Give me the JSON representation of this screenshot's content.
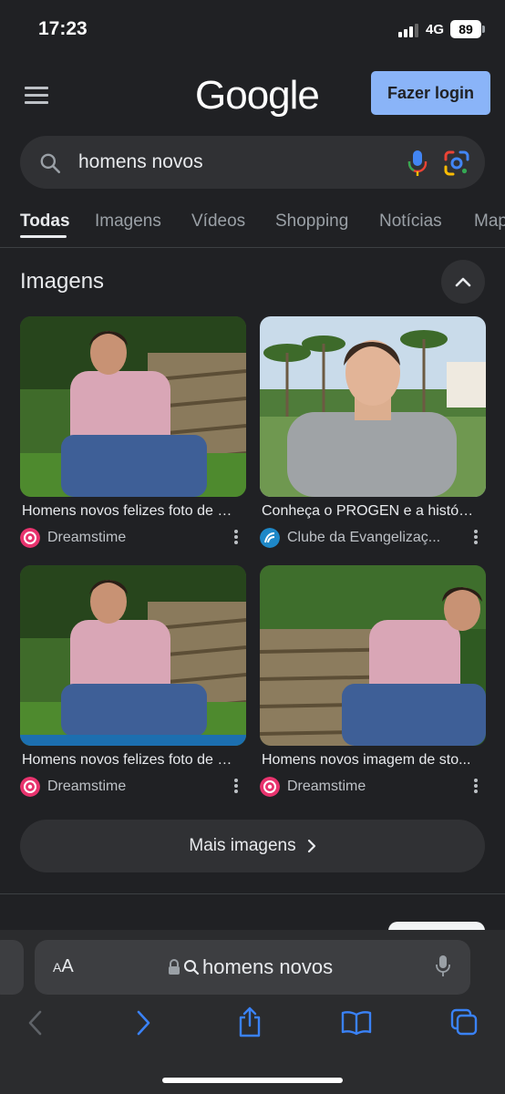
{
  "status_bar": {
    "time": "17:23",
    "network": "4G",
    "battery": "89"
  },
  "header": {
    "logo": "Google",
    "login_label": "Fazer login"
  },
  "search": {
    "query": "homens novos"
  },
  "tabs": [
    {
      "label": "Todas",
      "active": true
    },
    {
      "label": "Imagens"
    },
    {
      "label": "Vídeos"
    },
    {
      "label": "Shopping"
    },
    {
      "label": "Notícias"
    },
    {
      "label": "Map"
    }
  ],
  "images_section": {
    "title": "Imagens",
    "results": [
      {
        "caption": "Homens novos felizes foto de s...",
        "source": "Dreamstime",
        "favicon_color": "#e8336e"
      },
      {
        "caption": "Conheça o PROGEN e a históri...",
        "source": "Clube da Evangelizaç...",
        "favicon_color": "#1e88c8"
      },
      {
        "caption": "Homens novos felizes foto de s...",
        "source": "Dreamstime",
        "favicon_color": "#e8336e"
      },
      {
        "caption": "Homens novos imagem de sto...",
        "source": "Dreamstime",
        "favicon_color": "#e8336e"
      }
    ],
    "more_label": "Mais imagens"
  },
  "browser": {
    "aa_label": "AA",
    "address_text": "homens novos"
  },
  "colors": {
    "background": "#202124",
    "surface": "#303134",
    "accent": "#8ab4f8",
    "ios_blue": "#3a82f7"
  }
}
